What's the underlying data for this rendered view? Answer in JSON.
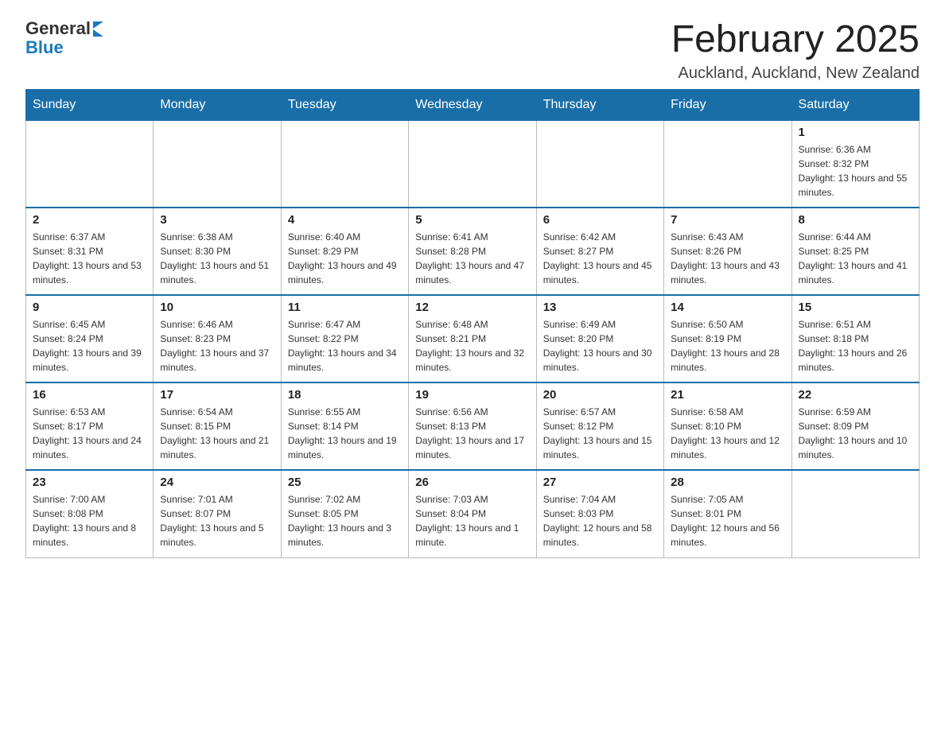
{
  "header": {
    "logo_general": "General",
    "logo_blue": "Blue",
    "month_title": "February 2025",
    "location": "Auckland, Auckland, New Zealand"
  },
  "weekdays": [
    "Sunday",
    "Monday",
    "Tuesday",
    "Wednesday",
    "Thursday",
    "Friday",
    "Saturday"
  ],
  "weeks": [
    [
      {
        "day": "",
        "info": ""
      },
      {
        "day": "",
        "info": ""
      },
      {
        "day": "",
        "info": ""
      },
      {
        "day": "",
        "info": ""
      },
      {
        "day": "",
        "info": ""
      },
      {
        "day": "",
        "info": ""
      },
      {
        "day": "1",
        "info": "Sunrise: 6:36 AM\nSunset: 8:32 PM\nDaylight: 13 hours and 55 minutes."
      }
    ],
    [
      {
        "day": "2",
        "info": "Sunrise: 6:37 AM\nSunset: 8:31 PM\nDaylight: 13 hours and 53 minutes."
      },
      {
        "day": "3",
        "info": "Sunrise: 6:38 AM\nSunset: 8:30 PM\nDaylight: 13 hours and 51 minutes."
      },
      {
        "day": "4",
        "info": "Sunrise: 6:40 AM\nSunset: 8:29 PM\nDaylight: 13 hours and 49 minutes."
      },
      {
        "day": "5",
        "info": "Sunrise: 6:41 AM\nSunset: 8:28 PM\nDaylight: 13 hours and 47 minutes."
      },
      {
        "day": "6",
        "info": "Sunrise: 6:42 AM\nSunset: 8:27 PM\nDaylight: 13 hours and 45 minutes."
      },
      {
        "day": "7",
        "info": "Sunrise: 6:43 AM\nSunset: 8:26 PM\nDaylight: 13 hours and 43 minutes."
      },
      {
        "day": "8",
        "info": "Sunrise: 6:44 AM\nSunset: 8:25 PM\nDaylight: 13 hours and 41 minutes."
      }
    ],
    [
      {
        "day": "9",
        "info": "Sunrise: 6:45 AM\nSunset: 8:24 PM\nDaylight: 13 hours and 39 minutes."
      },
      {
        "day": "10",
        "info": "Sunrise: 6:46 AM\nSunset: 8:23 PM\nDaylight: 13 hours and 37 minutes."
      },
      {
        "day": "11",
        "info": "Sunrise: 6:47 AM\nSunset: 8:22 PM\nDaylight: 13 hours and 34 minutes."
      },
      {
        "day": "12",
        "info": "Sunrise: 6:48 AM\nSunset: 8:21 PM\nDaylight: 13 hours and 32 minutes."
      },
      {
        "day": "13",
        "info": "Sunrise: 6:49 AM\nSunset: 8:20 PM\nDaylight: 13 hours and 30 minutes."
      },
      {
        "day": "14",
        "info": "Sunrise: 6:50 AM\nSunset: 8:19 PM\nDaylight: 13 hours and 28 minutes."
      },
      {
        "day": "15",
        "info": "Sunrise: 6:51 AM\nSunset: 8:18 PM\nDaylight: 13 hours and 26 minutes."
      }
    ],
    [
      {
        "day": "16",
        "info": "Sunrise: 6:53 AM\nSunset: 8:17 PM\nDaylight: 13 hours and 24 minutes."
      },
      {
        "day": "17",
        "info": "Sunrise: 6:54 AM\nSunset: 8:15 PM\nDaylight: 13 hours and 21 minutes."
      },
      {
        "day": "18",
        "info": "Sunrise: 6:55 AM\nSunset: 8:14 PM\nDaylight: 13 hours and 19 minutes."
      },
      {
        "day": "19",
        "info": "Sunrise: 6:56 AM\nSunset: 8:13 PM\nDaylight: 13 hours and 17 minutes."
      },
      {
        "day": "20",
        "info": "Sunrise: 6:57 AM\nSunset: 8:12 PM\nDaylight: 13 hours and 15 minutes."
      },
      {
        "day": "21",
        "info": "Sunrise: 6:58 AM\nSunset: 8:10 PM\nDaylight: 13 hours and 12 minutes."
      },
      {
        "day": "22",
        "info": "Sunrise: 6:59 AM\nSunset: 8:09 PM\nDaylight: 13 hours and 10 minutes."
      }
    ],
    [
      {
        "day": "23",
        "info": "Sunrise: 7:00 AM\nSunset: 8:08 PM\nDaylight: 13 hours and 8 minutes."
      },
      {
        "day": "24",
        "info": "Sunrise: 7:01 AM\nSunset: 8:07 PM\nDaylight: 13 hours and 5 minutes."
      },
      {
        "day": "25",
        "info": "Sunrise: 7:02 AM\nSunset: 8:05 PM\nDaylight: 13 hours and 3 minutes."
      },
      {
        "day": "26",
        "info": "Sunrise: 7:03 AM\nSunset: 8:04 PM\nDaylight: 13 hours and 1 minute."
      },
      {
        "day": "27",
        "info": "Sunrise: 7:04 AM\nSunset: 8:03 PM\nDaylight: 12 hours and 58 minutes."
      },
      {
        "day": "28",
        "info": "Sunrise: 7:05 AM\nSunset: 8:01 PM\nDaylight: 12 hours and 56 minutes."
      },
      {
        "day": "",
        "info": ""
      }
    ]
  ]
}
